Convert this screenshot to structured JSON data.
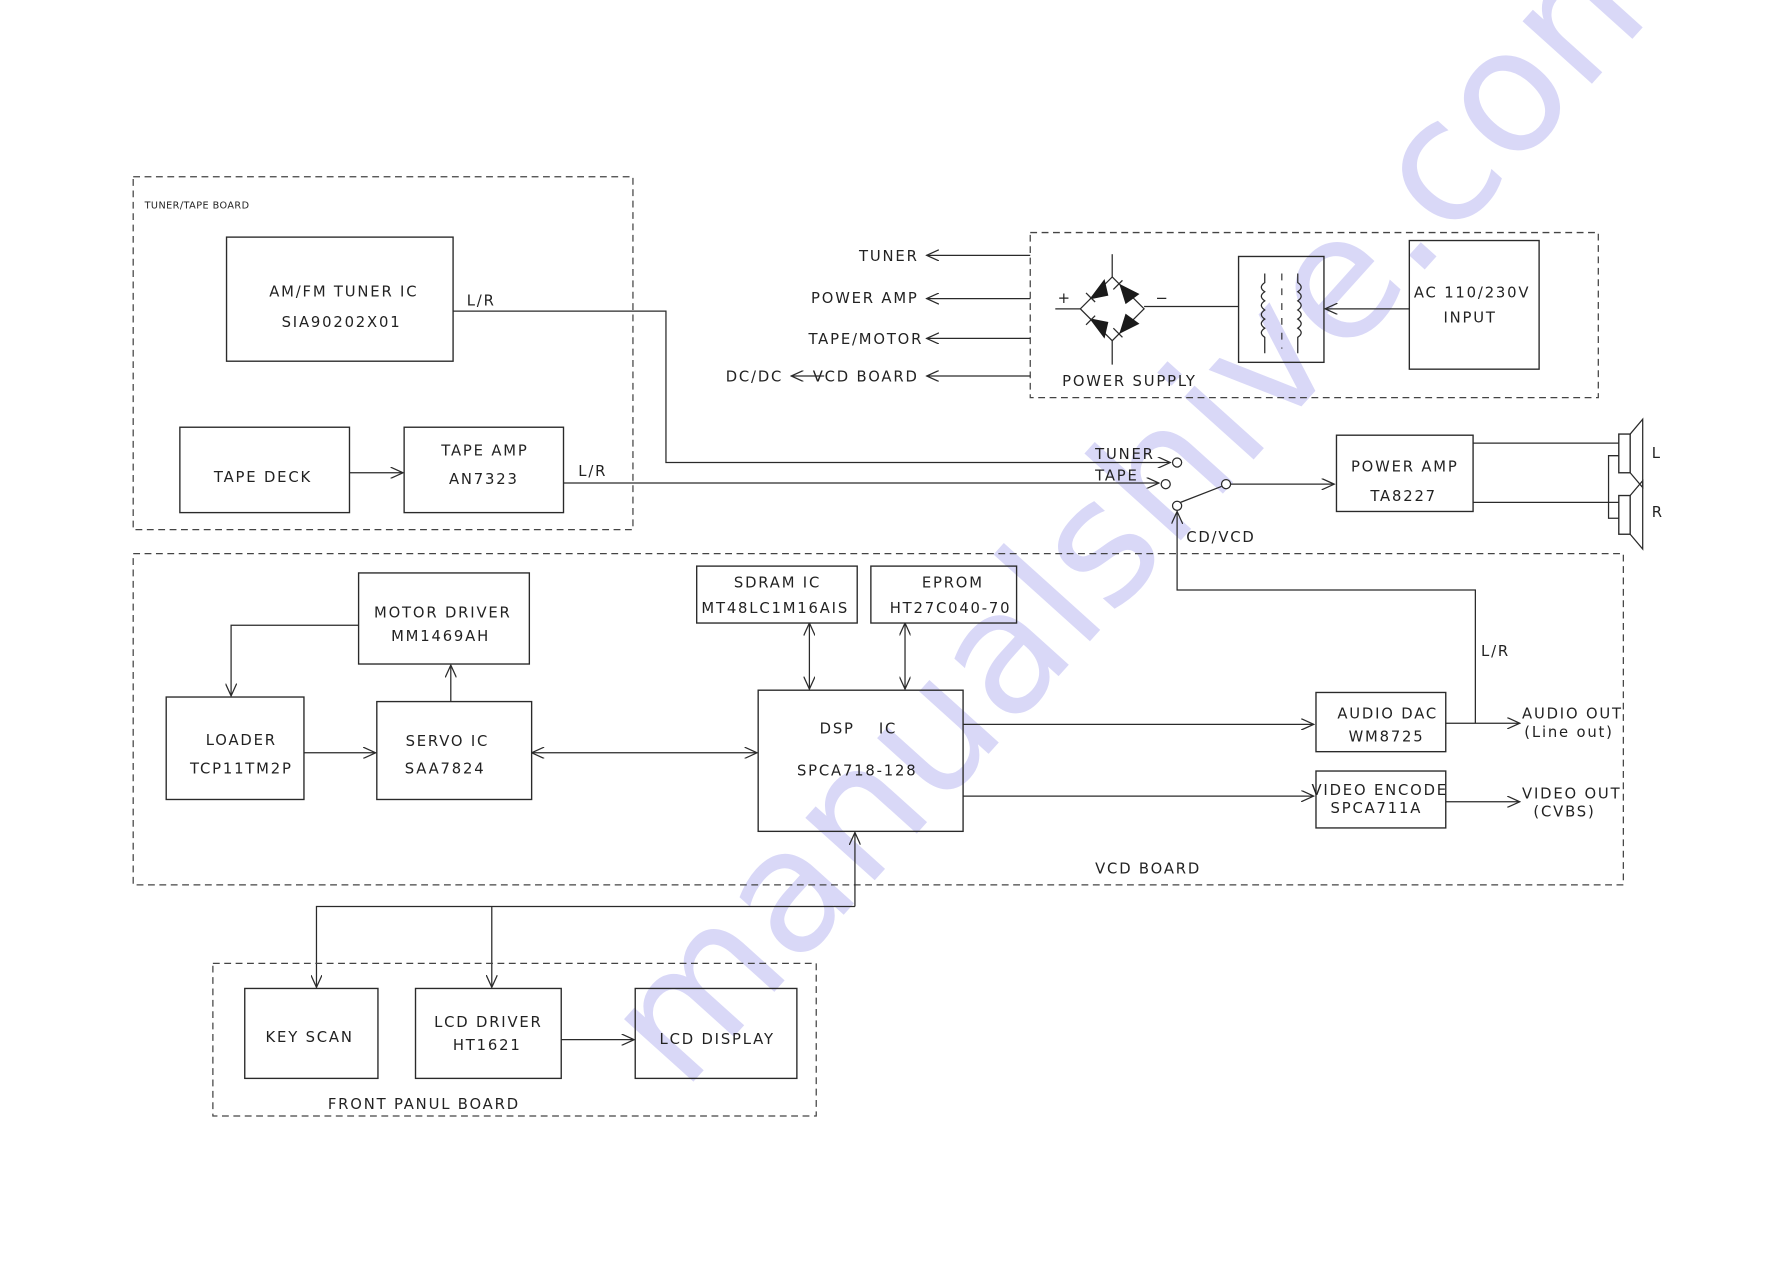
{
  "watermark": {
    "text": "manualshive.com",
    "color": "#c9c8f5"
  },
  "boards": {
    "tuner_tape": {
      "label": "TUNER/TAPE BOARD"
    },
    "power_supply": {
      "label": "POWER SUPPLY"
    },
    "vcd": {
      "label": "VCD BOARD"
    },
    "front_panel": {
      "label": "FRONT PANUL BOARD"
    }
  },
  "blocks": {
    "tuner_ic": {
      "line1": "AM/FM TUNER IC",
      "line2": "SIA90202X01"
    },
    "tape_deck": {
      "line1": "TAPE DECK"
    },
    "tape_amp": {
      "line1": "TAPE AMP",
      "line2": "AN7323"
    },
    "ac_input": {
      "line1": "AC 110/230V",
      "line2": "INPUT"
    },
    "power_amp": {
      "line1": "POWER AMP",
      "line2": "TA8227"
    },
    "motor_driver": {
      "line1": "MOTOR DRIVER",
      "line2": "MM1469AH"
    },
    "loader": {
      "line1": "LOADER",
      "line2": "TCP11TM2P"
    },
    "servo_ic": {
      "line1": "SERVO IC",
      "line2": "SAA7824"
    },
    "sdram_ic": {
      "line1": "SDRAM IC",
      "line2": "MT48LC1M16AIS"
    },
    "eprom": {
      "line1": "EPROM",
      "line2": "HT27C040-70"
    },
    "dsp_ic": {
      "line1a": "DSP",
      "line1b": "IC",
      "line2": "SPCA718-128"
    },
    "audio_dac": {
      "line1": "AUDIO DAC",
      "line2": "WM8725"
    },
    "video_encode": {
      "line1": "VIDEO ENCODE",
      "line2": "SPCA711A"
    },
    "key_scan": {
      "line1": "KEY SCAN"
    },
    "lcd_driver": {
      "line1": "LCD DRIVER",
      "line2": "HT1621"
    },
    "lcd_display": {
      "line1": "LCD DISPLAY"
    }
  },
  "power_outputs": [
    "TUNER",
    "POWER AMP",
    "TAPE/MOTOR",
    "VCD BOARD"
  ],
  "dcdc_label": "DC/DC",
  "polarity": {
    "plus": "+",
    "minus": "−"
  },
  "signal_labels": {
    "tuner_lr": "L/R",
    "tape_lr": "L/R",
    "dac_lr": "L/R",
    "switch_tuner": "TUNER",
    "switch_tape": "TAPE",
    "switch_cdvcd": "CD/VCD",
    "speaker_left": "L",
    "speaker_right": "R"
  },
  "outputs": {
    "audio_out_1": "AUDIO OUT",
    "audio_out_2": "(Line out)",
    "video_out_1": "VIDEO OUT",
    "video_out_2": "(CVBS)"
  }
}
